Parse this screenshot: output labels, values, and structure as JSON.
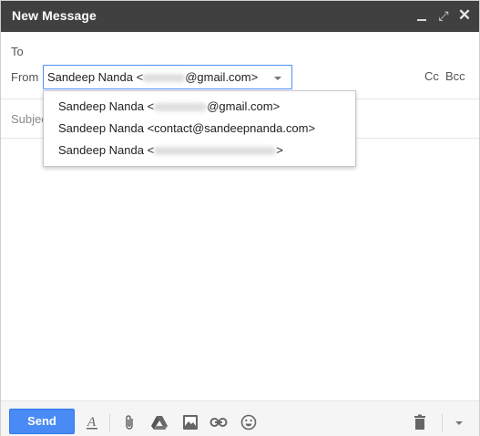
{
  "window": {
    "title": "New Message",
    "controls": [
      "minimize-icon",
      "maximize-icon",
      "close-icon"
    ],
    "close_glyph": "✕",
    "maximize_glyph": "⤢"
  },
  "fields": {
    "to_label": "To",
    "from_label": "From",
    "subject_label": "Subject",
    "cc_label": "Cc",
    "bcc_label": "Bcc"
  },
  "from_select": {
    "name": "Sandeep Nanda <",
    "email_suffix": "@gmail.com>"
  },
  "from_options": [
    {
      "name": "Sandeep Nanda <",
      "email_suffix": "@gmail.com>"
    },
    {
      "name": "Sandeep Nanda <contact@sandeepnanda.com>",
      "email_suffix": ""
    },
    {
      "name": "Sandeep Nanda <",
      "email_suffix": ">"
    }
  ],
  "toolbar": {
    "send_label": "Send",
    "icons": [
      "format-text-icon",
      "attach-icon",
      "drive-icon",
      "photo-icon",
      "link-icon",
      "emoji-icon",
      "trash-icon",
      "more-options-icon"
    ]
  },
  "colors": {
    "titlebar": "#404040",
    "send_button": "#4a8af4",
    "focus_border": "#4d90fe"
  }
}
